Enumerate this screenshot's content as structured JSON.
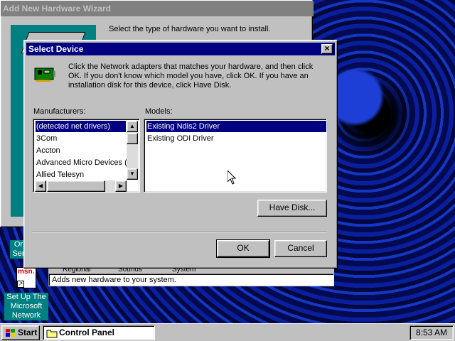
{
  "wizard": {
    "title": "Add New Hardware Wizard",
    "instruction": "Select the type of hardware you want to install.",
    "status": "Adds new hardware to your system.",
    "tabs": [
      "Regional",
      "Sounds",
      "System"
    ]
  },
  "dialog": {
    "title": "Select Device",
    "description": "Click the Network adapters that matches your hardware, and then click OK. If you don't know which model you have, click OK. If you have an installation disk for this device, click Have Disk.",
    "manufacturers_label": "Manufacturers:",
    "models_label": "Models:",
    "manufacturers": [
      "(detected net drivers)",
      "3Com",
      "Accton",
      "Advanced Micro Devices (AI",
      "Allied Telesyn"
    ],
    "models": [
      "Existing Ndis2 Driver",
      "Existing ODI Driver"
    ],
    "selected_manufacturer": "(detected net drivers)",
    "selected_model": "Existing Ndis2 Driver",
    "have_disk_label": "Have Disk...",
    "ok_label": "OK",
    "cancel_label": "Cancel"
  },
  "desktop_icons": {
    "partial_label_1": "Or",
    "partial_label_2": "Ser",
    "msn_logo_text": "msn.",
    "msn_label_line1": "Set Up The",
    "msn_label_line2": "Microsoft",
    "msn_label_line3": "Network"
  },
  "taskbar": {
    "start_label": "Start",
    "task_label": "Control Panel",
    "clock": "8:53 AM"
  },
  "colors": {
    "titlebar_active": "#000080",
    "titlebar_inactive": "#808080",
    "face": "#c0c0c0",
    "selection": "#000080",
    "desktop_teal": "#008080"
  }
}
